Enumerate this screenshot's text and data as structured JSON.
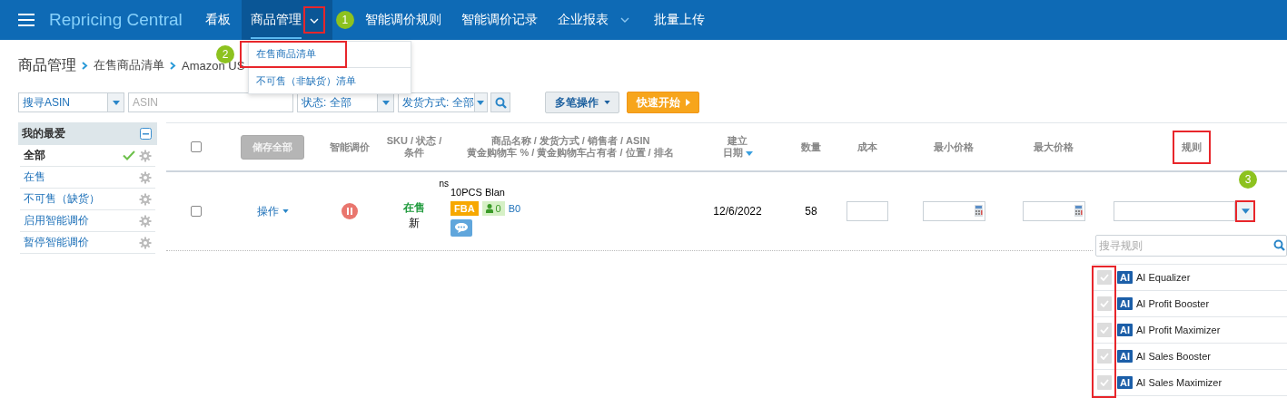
{
  "nav": {
    "logo": "Repricing Central",
    "items": [
      {
        "label": "看板",
        "selected": false,
        "has_caret": false
      },
      {
        "label": "商品管理",
        "selected": true,
        "has_caret": true,
        "highlighted": true,
        "step": "1"
      },
      {
        "label": "智能调价规则",
        "selected": false,
        "has_caret": false
      },
      {
        "label": "智能调价记录",
        "selected": false,
        "has_caret": false
      },
      {
        "label": "企业报表",
        "selected": false,
        "has_caret": true
      },
      {
        "label": "批量上传",
        "selected": false,
        "has_caret": false
      }
    ]
  },
  "submenu": {
    "items": [
      {
        "label": "在售商品清单",
        "highlighted": true,
        "step": "2"
      },
      {
        "label": "不可售（非缺货）清单",
        "highlighted": false
      }
    ]
  },
  "breadcrumb": [
    "商品管理",
    "在售商品清单",
    "Amazon US"
  ],
  "filters": {
    "search_type": "搜寻ASIN",
    "search_placeholder": "ASIN",
    "status": "状态: 全部",
    "shipping": "发货方式: 全部",
    "bulk_button": "多笔操作",
    "quick_start_button": "快速开始"
  },
  "sidebar": {
    "title": "我的最爱",
    "items": [
      {
        "label": "全部",
        "selected": true
      },
      {
        "label": "在售",
        "selected": false
      },
      {
        "label": "不可售（缺货）",
        "selected": false
      },
      {
        "label": "启用智能调价",
        "selected": false
      },
      {
        "label": "暂停智能调价",
        "selected": false
      }
    ]
  },
  "table": {
    "header_checked": false,
    "save_all_button": "储存全部",
    "columns": [
      {
        "lines": [
          "智能调价"
        ],
        "sorted": false,
        "highlighted": false
      },
      {
        "lines": [
          "SKU / 状态 /",
          "条件"
        ],
        "sorted": false,
        "highlighted": false
      },
      {
        "lines": [
          "商品名称 / 发货方式 / 销售者 / ASIN",
          "黄金购物车 % / 黄金购物车占有者 / 位置 / 排名"
        ],
        "sorted": false,
        "highlighted": false
      },
      {
        "lines": [
          "建立",
          "日期"
        ],
        "sorted": true,
        "highlighted": false
      },
      {
        "lines": [
          "数量"
        ],
        "sorted": false,
        "highlighted": false
      },
      {
        "lines": [
          "成本"
        ],
        "sorted": false,
        "highlighted": false
      },
      {
        "lines": [
          "最小价格"
        ],
        "sorted": false,
        "highlighted": false
      },
      {
        "lines": [
          "最大价格"
        ],
        "sorted": false,
        "highlighted": false
      },
      {
        "lines": [
          "规则"
        ],
        "sorted": false,
        "highlighted": true
      }
    ],
    "rows": [
      {
        "checked": false,
        "action": "操作",
        "paused": true,
        "sku": "ns",
        "status": "在售",
        "condition": "新",
        "title": "10PCS Blan",
        "fulfillment": "FBA",
        "sellers": "0",
        "asin": "B0",
        "date": "12/6/2022",
        "quantity": "58",
        "rule_button_highlighted": true,
        "step": "3"
      }
    ]
  },
  "rule_panel": {
    "search_placeholder": "搜寻规则",
    "checkboxes_highlighted": true,
    "rules": [
      {
        "badge": "AI",
        "label": "AI Equalizer",
        "checked": false
      },
      {
        "badge": "AI",
        "label": "AI Profit Booster",
        "checked": false
      },
      {
        "badge": "AI",
        "label": "AI Profit Maximizer",
        "checked": false
      },
      {
        "badge": "AI",
        "label": "AI Sales Booster",
        "checked": false
      },
      {
        "badge": "AI",
        "label": "AI Sales Maximizer",
        "checked": false
      }
    ]
  }
}
